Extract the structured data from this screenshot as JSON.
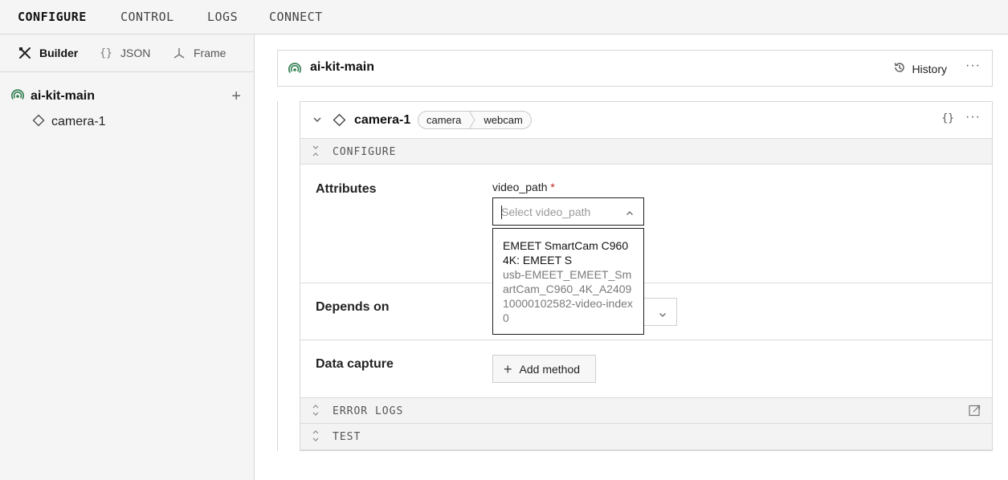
{
  "topnav": {
    "tabs": [
      "CONFIGURE",
      "CONTROL",
      "LOGS",
      "CONNECT"
    ]
  },
  "sidebar": {
    "modes": [
      "Builder",
      "JSON",
      "Frame"
    ],
    "tree": {
      "root": "ai-kit-main",
      "children": [
        "camera-1"
      ]
    }
  },
  "robot": {
    "name": "ai-kit-main",
    "history_label": "History",
    "more": "···"
  },
  "component": {
    "name": "camera-1",
    "api": "camera",
    "model": "webcam",
    "json_label": "{}",
    "more": "···",
    "sections": {
      "configure": "CONFIGURE",
      "error_logs": "ERROR LOGS",
      "test": "TEST"
    },
    "attributes": {
      "label": "Attributes",
      "field_label": "video_path",
      "required_mark": "*",
      "placeholder": "Select video_path"
    },
    "depends_on": {
      "label": "Depends on"
    },
    "data_capture": {
      "label": "Data capture",
      "add_method_label": "Add method"
    },
    "dropdown": {
      "options": [
        {
          "title": "EMEET SmartCam C960 4K: EMEET S",
          "subtitle": "usb-EMEET_EMEET_SmartCam_C960_4K_A240910000102582-video-index0"
        }
      ]
    }
  },
  "colors": {
    "live_green": "#2e7d4f",
    "required_red": "#c0262d",
    "nav_bg": "#f5f5f5",
    "border": "#d8d8d8"
  }
}
